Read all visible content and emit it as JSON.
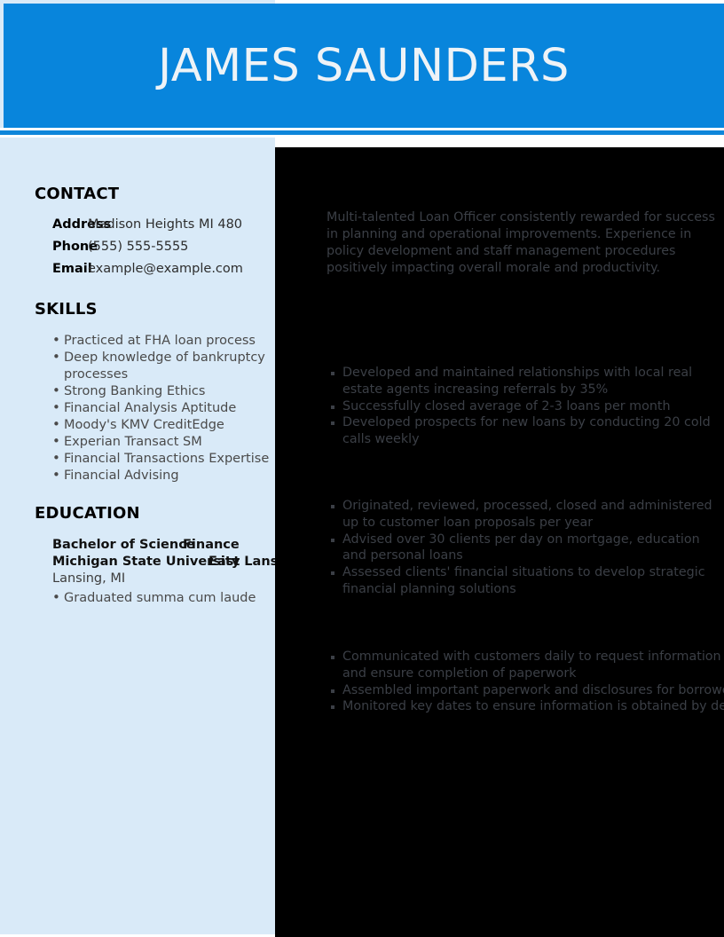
{
  "document": {
    "type": "resume",
    "name": "JAMES SAUNDERS"
  },
  "theme": {
    "header_blue": "#0885dc",
    "rule_blue": "#0e86da",
    "sidebar_blue": "#d9eaf8",
    "main_background": "#000000",
    "main_text": "#3b3f46",
    "header_text": "#eef3f7",
    "sidebar_heading": "#000000",
    "sidebar_text": "#4a4a4a"
  },
  "header": {
    "name": "JAMES SAUNDERS"
  },
  "sidebar": {
    "contact": {
      "heading": "CONTACT",
      "rows": [
        {
          "label": "Address",
          "value": "Madison Heights MI 480"
        },
        {
          "label": "Phone",
          "value": "(555) 555-5555"
        },
        {
          "label": "Email",
          "value": "example@example.com"
        }
      ]
    },
    "skills": {
      "heading": "SKILLS",
      "items": [
        "Practiced at FHA loan process",
        "Deep knowledge of bankruptcy processes",
        "Strong Banking Ethics",
        "Financial Analysis Aptitude",
        "Moody's KMV CreditEdge",
        "Experian Transact SM",
        "Financial Transactions Expertise",
        "Financial Advising"
      ]
    },
    "education": {
      "heading": "EDUCATION",
      "degree": "Bachelor of Science",
      "major": "Finance",
      "school": "Michigan State University",
      "city": "East Lansing",
      "location": "Lansing, MI",
      "honors": [
        "Graduated summa cum laude"
      ]
    }
  },
  "main": {
    "summary": "Multi-talented Loan Officer consistently rewarded for success in planning and operational improvements. Experience in policy development and staff management procedures positively impacting overall morale and productivity.",
    "experience_groups": [
      {
        "bullets": [
          "Developed and maintained relationships with local real estate agents increasing referrals by 35%",
          "Successfully closed average of 2-3 loans per month",
          "Developed prospects for new loans by conducting 20 cold calls weekly"
        ]
      },
      {
        "bullets": [
          "Originated, reviewed, processed, closed and administered up to customer loan proposals per year",
          "Advised over 30 clients per day on mortgage, education and personal loans",
          "Assessed clients' financial situations to develop strategic financial planning solutions"
        ]
      },
      {
        "bullets": [
          "Communicated with customers daily to request information and ensure completion of paperwork",
          "Assembled important paperwork and disclosures for borrowers",
          "Monitored key dates to ensure information is obtained by deadline"
        ]
      }
    ]
  }
}
